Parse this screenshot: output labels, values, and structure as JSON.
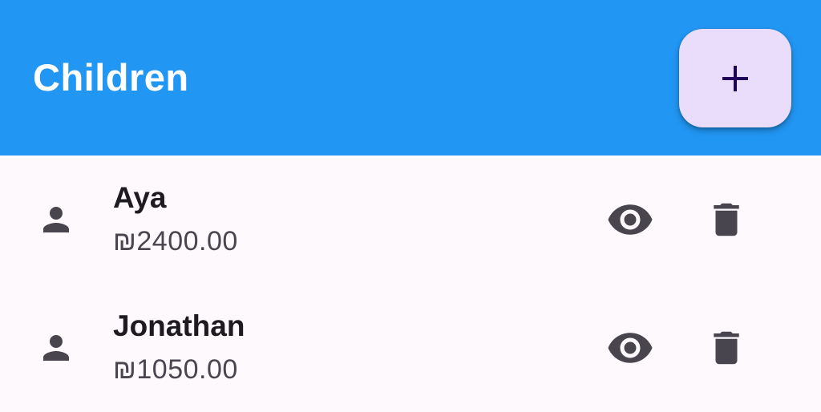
{
  "app_bar": {
    "title": "Children",
    "add_button_icon": "plus-icon",
    "background_color": "#2196F3",
    "fab_color": "#EADDFB"
  },
  "children": [
    {
      "name": "Aya",
      "balance": "₪2400.00"
    },
    {
      "name": "Jonathan",
      "balance": "₪1050.00"
    }
  ],
  "icons": {
    "child": "person-icon",
    "view": "eye-icon",
    "delete": "trash-icon"
  }
}
